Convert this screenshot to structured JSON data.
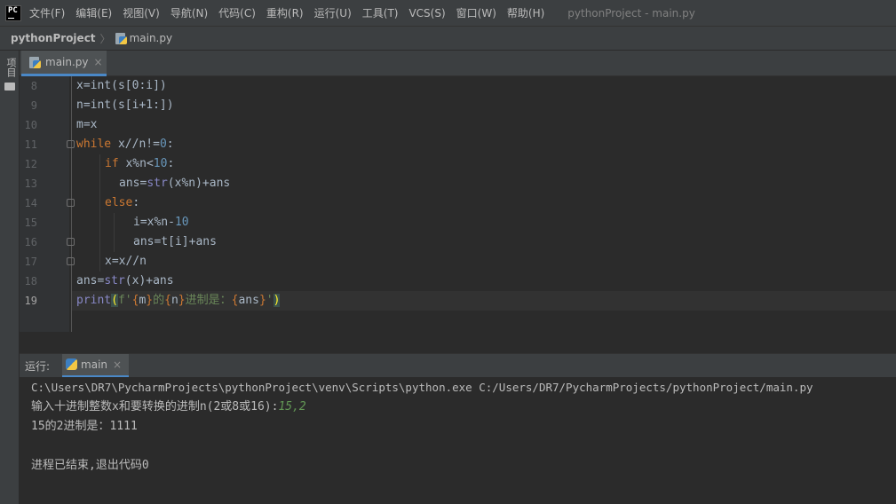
{
  "menu": {
    "logo_text": "PC",
    "items": [
      "文件(F)",
      "编辑(E)",
      "视图(V)",
      "导航(N)",
      "代码(C)",
      "重构(R)",
      "运行(U)",
      "工具(T)",
      "VCS(S)",
      "窗口(W)",
      "帮助(H)"
    ],
    "window_title": "pythonProject - main.py"
  },
  "breadcrumb": {
    "project": "pythonProject",
    "separator": "〉",
    "file": "main.py"
  },
  "toolstrip": {
    "project_label": "项目"
  },
  "editor_tab": {
    "label": "main.py",
    "close": "×"
  },
  "editor": {
    "current_line": 19,
    "lines": [
      {
        "n": "8"
      },
      {
        "n": "9"
      },
      {
        "n": "10"
      },
      {
        "n": "11"
      },
      {
        "n": "12"
      },
      {
        "n": "13"
      },
      {
        "n": "14"
      },
      {
        "n": "15"
      },
      {
        "n": "16"
      },
      {
        "n": "17"
      },
      {
        "n": "18"
      },
      {
        "n": "19"
      }
    ],
    "code": {
      "l8": "x=int(s[0:i])",
      "l9": "n=int(s[i+1:])",
      "l10": "m=x",
      "l11_kw": "while",
      "l11_rest": " x//n!=",
      "l11_num": "0",
      "l11_end": ":",
      "l12_kw": "if",
      "l12_rest": " x%n<",
      "l12_num": "10",
      "l12_end": ":",
      "l13_a": "ans=",
      "l13_bi": "str",
      "l13_b": "(x%n)+ans",
      "l14_kw": "else",
      "l14_end": ":",
      "l15_a": "i=x%n-",
      "l15_num": "10",
      "l16": "ans=t[i]+ans",
      "l17": "x=x//n",
      "l18_a": "ans=",
      "l18_bi": "str",
      "l18_b": "(x)+ans",
      "l19_fn": "print",
      "l19_open": "(",
      "l19_f": "f'",
      "l19_b1": "{",
      "l19_m": "m",
      "l19_b2": "}",
      "l19_s1": "的",
      "l19_b3": "{",
      "l19_n": "n",
      "l19_b4": "}",
      "l19_s2": "进制是：",
      "l19_b5": "{",
      "l19_ans": "ans",
      "l19_b6": "}",
      "l19_q": "'",
      "l19_close": ")"
    }
  },
  "run_panel": {
    "title": "运行:",
    "tab_label": "main",
    "tab_close": "×",
    "console": {
      "command": "C:\\Users\\DR7\\PycharmProjects\\pythonProject\\venv\\Scripts\\python.exe C:/Users/DR7/PycharmProjects/pythonProject/main.py",
      "prompt": "输入十进制整数x和要转换的进制n(2或8或16):",
      "user_input": "15,2",
      "result": "15的2进制是：1111",
      "exit_message": "进程已结束,退出代码0"
    }
  },
  "colors": {
    "keyword": "#cc7832",
    "builtin": "#8888c6",
    "number": "#6897bb",
    "string": "#6a8759",
    "input_echo": "#629755"
  }
}
